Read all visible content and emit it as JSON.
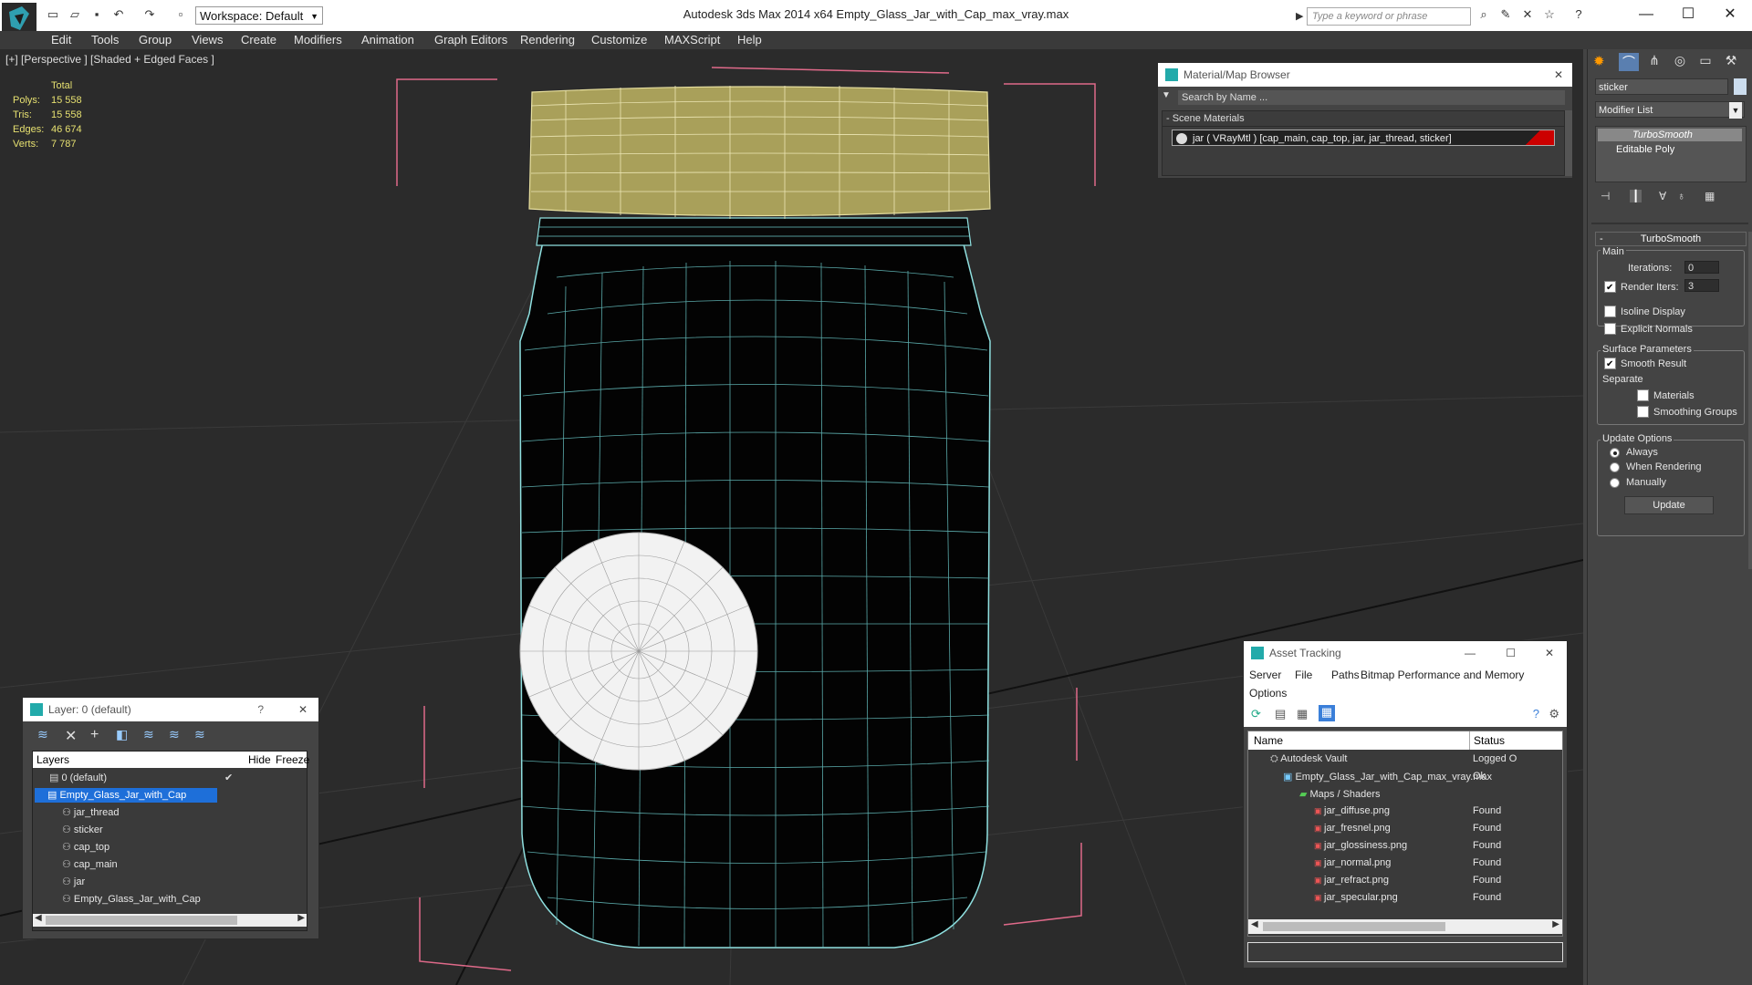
{
  "app": {
    "title": "Autodesk 3ds Max  2014 x64       Empty_Glass_Jar_with_Cap_max_vray.max",
    "workspace": "Workspace: Default",
    "search_placeholder": "Type a keyword or phrase"
  },
  "menu": [
    "Edit",
    "Tools",
    "Group",
    "Views",
    "Create",
    "Modifiers",
    "Animation",
    "Graph Editors",
    "Rendering",
    "Customize",
    "MAXScript",
    "Help"
  ],
  "viewport": {
    "label": "[+] [Perspective ] [Shaded + Edged Faces ]",
    "stats_header": "Total",
    "stats": [
      {
        "label": "Polys:",
        "value": "15 558"
      },
      {
        "label": "Tris:",
        "value": "15 558"
      },
      {
        "label": "Edges:",
        "value": "46 674"
      },
      {
        "label": "Verts:",
        "value": "7 787"
      }
    ]
  },
  "material_browser": {
    "title": "Material/Map Browser",
    "search_placeholder": "Search by Name ...",
    "section": "- Scene Materials",
    "item": "jar  ( VRayMtl )  [cap_main, cap_top, jar, jar_thread, sticker]"
  },
  "command_panel": {
    "object_name": "sticker",
    "modifier_list": "Modifier List",
    "stack": [
      "TurboSmooth",
      "Editable Poly"
    ],
    "rollout_title": "TurboSmooth",
    "main_label": "Main",
    "iterations_label": "Iterations:",
    "iterations_value": "0",
    "render_iters_label": "Render Iters:",
    "render_iters_value": "3",
    "isoline": "Isoline Display",
    "explicit_normals": "Explicit Normals",
    "surface_params": "Surface Parameters",
    "smooth_result": "Smooth Result",
    "separate": "Separate",
    "materials": "Materials",
    "smoothing_groups": "Smoothing Groups",
    "update_options": "Update Options",
    "always": "Always",
    "when_rendering": "When Rendering",
    "manually": "Manually",
    "update_btn": "Update"
  },
  "layer_panel": {
    "title": "Layer: 0 (default)",
    "help": "?",
    "col_layers": "Layers",
    "col_hide": "Hide",
    "col_freeze": "Freeze",
    "rows": [
      "0 (default)",
      "Empty_Glass_Jar_with_Cap",
      "jar_thread",
      "sticker",
      "cap_top",
      "cap_main",
      "jar",
      "Empty_Glass_Jar_with_Cap"
    ]
  },
  "asset_tracking": {
    "title": "Asset Tracking",
    "menu": [
      "Server",
      "File",
      "Paths",
      "Bitmap Performance and Memory",
      "Options"
    ],
    "col_name": "Name",
    "col_status": "Status",
    "rows": [
      {
        "name": "Autodesk Vault",
        "status": "Logged O"
      },
      {
        "name": "Empty_Glass_Jar_with_Cap_max_vray.max",
        "status": "Ok"
      },
      {
        "name": "Maps / Shaders",
        "status": ""
      },
      {
        "name": "jar_diffuse.png",
        "status": "Found"
      },
      {
        "name": "jar_fresnel.png",
        "status": "Found"
      },
      {
        "name": "jar_glossiness.png",
        "status": "Found"
      },
      {
        "name": "jar_normal.png",
        "status": "Found"
      },
      {
        "name": "jar_refract.png",
        "status": "Found"
      },
      {
        "name": "jar_specular.png",
        "status": "Found"
      }
    ]
  }
}
